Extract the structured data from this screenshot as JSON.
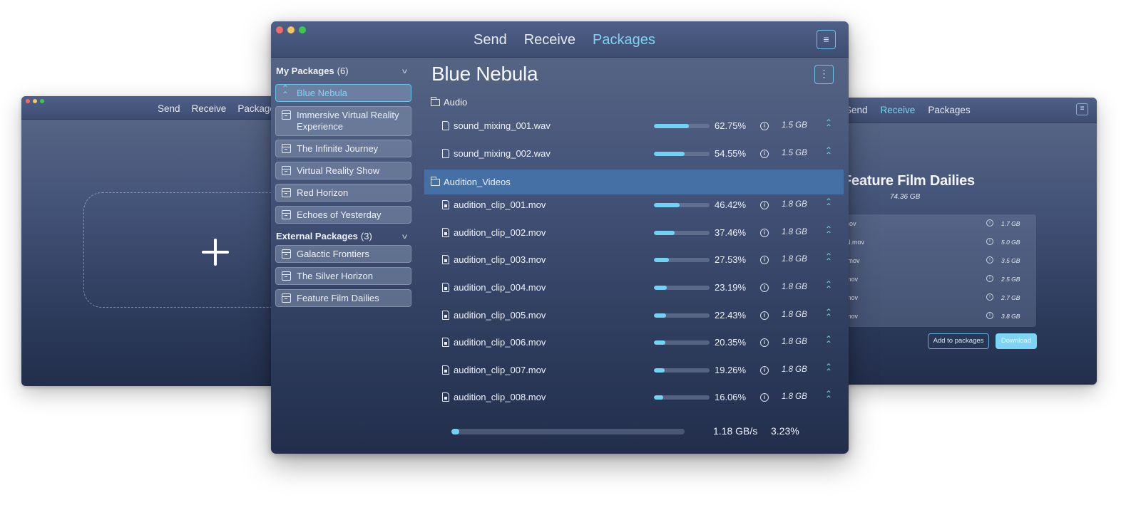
{
  "nav": {
    "send": "Send",
    "receive": "Receive",
    "packages": "Packages"
  },
  "left_window": {
    "active_tab": "Send",
    "dropzone_icon": "plus-icon"
  },
  "right_window": {
    "active_tab": "Receive",
    "menu_icon": "≡",
    "package_title": "Feature Film Dailies",
    "package_size": "74.36 GB",
    "files": [
      {
        "name": "nov",
        "size": "1.7 GB"
      },
      {
        "name": "N.mov",
        "size": "5.0 GB"
      },
      {
        "name": ".mov",
        "size": "3.5 GB"
      },
      {
        "name": "mov",
        "size": "2.5 GB"
      },
      {
        "name": "mov",
        "size": "2.7 GB"
      },
      {
        "name": "mov",
        "size": "3.8 GB"
      }
    ],
    "add_button": "Add to packages",
    "download_button": "Download"
  },
  "main_window": {
    "active_tab": "Packages",
    "menu_icon": "≡",
    "more_icon": "⋮",
    "sidebar": {
      "my_packages": {
        "label": "My Packages",
        "count": "(6)",
        "items": [
          "Blue Nebula",
          "Immersive Virtual Reality Experience",
          "The Infinite Journey",
          "Virtual Reality Show",
          "Red Horizon",
          "Echoes of Yesterday"
        ],
        "selected": "Blue Nebula"
      },
      "external_packages": {
        "label": "External Packages",
        "count": "(3)",
        "items": [
          "Galactic Frontiers",
          "The Silver Horizon",
          "Feature Film Dailies"
        ]
      }
    },
    "package_title": "Blue Nebula",
    "folders": [
      {
        "name": "Audio",
        "highlighted": false,
        "files": [
          {
            "name": "sound_mixing_001.wav",
            "type": "audio",
            "progress": 62.75,
            "percent": "62.75%",
            "size": "1.5 GB"
          },
          {
            "name": "sound_mixing_002.wav",
            "type": "audio",
            "progress": 54.55,
            "percent": "54.55%",
            "size": "1.5 GB"
          }
        ]
      },
      {
        "name": "Audition_Videos",
        "highlighted": true,
        "files": [
          {
            "name": "audition_clip_001.mov",
            "type": "video",
            "progress": 46.42,
            "percent": "46.42%",
            "size": "1.8 GB"
          },
          {
            "name": "audition_clip_002.mov",
            "type": "video",
            "progress": 37.46,
            "percent": "37.46%",
            "size": "1.8 GB"
          },
          {
            "name": "audition_clip_003.mov",
            "type": "video",
            "progress": 27.53,
            "percent": "27.53%",
            "size": "1.8 GB"
          },
          {
            "name": "audition_clip_004.mov",
            "type": "video",
            "progress": 23.19,
            "percent": "23.19%",
            "size": "1.8 GB"
          },
          {
            "name": "audition_clip_005.mov",
            "type": "video",
            "progress": 22.43,
            "percent": "22.43%",
            "size": "1.8 GB"
          },
          {
            "name": "audition_clip_006.mov",
            "type": "video",
            "progress": 20.35,
            "percent": "20.35%",
            "size": "1.8 GB"
          },
          {
            "name": "audition_clip_007.mov",
            "type": "video",
            "progress": 19.26,
            "percent": "19.26%",
            "size": "1.8 GB"
          },
          {
            "name": "audition_clip_008.mov",
            "type": "video",
            "progress": 16.06,
            "percent": "16.06%",
            "size": "1.8 GB"
          }
        ]
      }
    ],
    "footer": {
      "speed": "1.18 GB/s",
      "total_percent": "3.23%",
      "total_progress": 3.23
    }
  },
  "colors": {
    "accent": "#7fd2f0",
    "progress": "#72d2f4",
    "priority": "#6fd3c8",
    "highlight_row": "#4470a6"
  }
}
